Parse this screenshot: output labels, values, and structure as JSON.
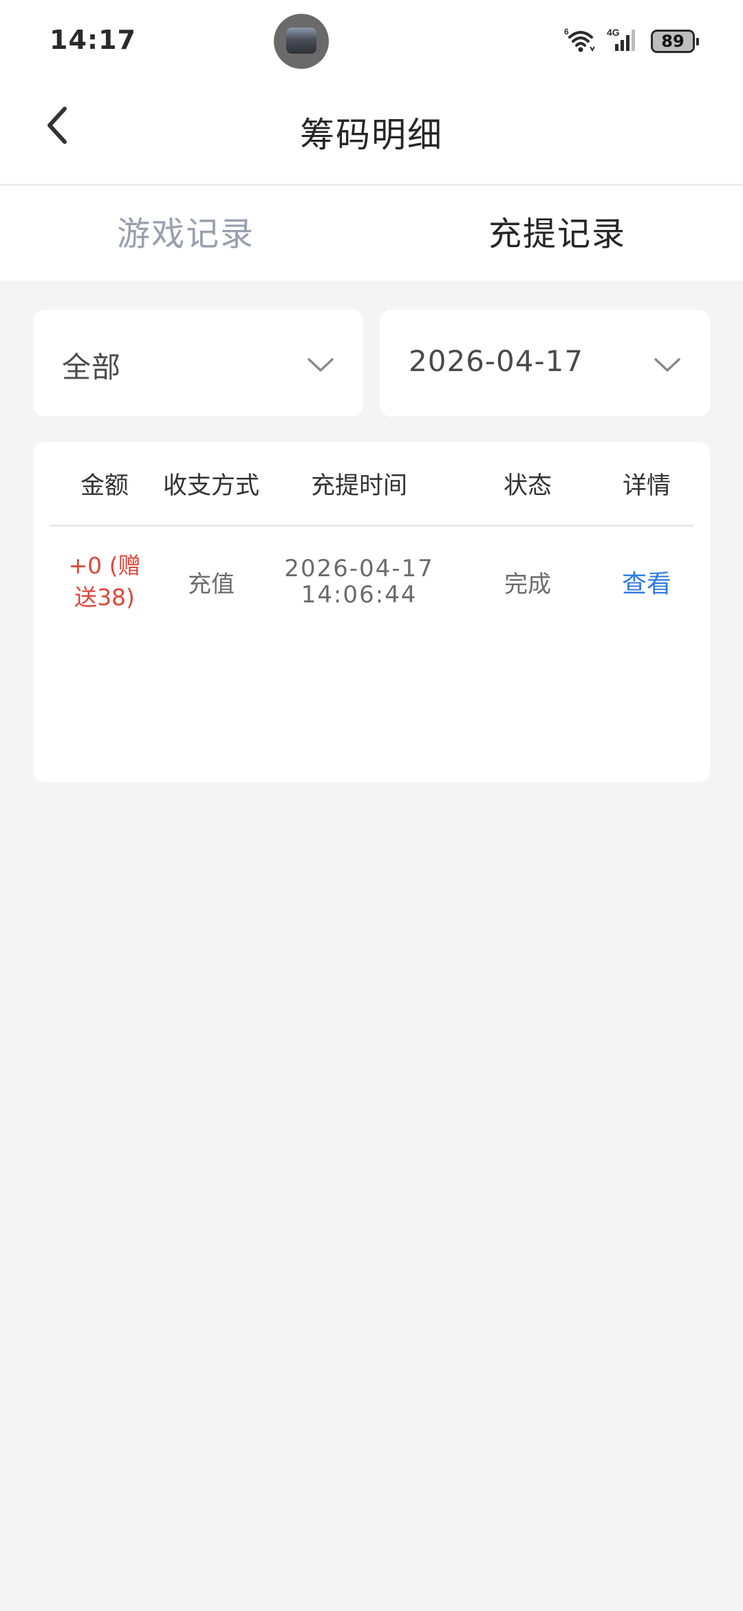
{
  "status_bar": {
    "time": "14:17",
    "battery": "89",
    "icons": [
      "wifi-icon",
      "cellular-4g-icon",
      "battery-icon"
    ]
  },
  "header": {
    "title": "筹码明细"
  },
  "tabs": [
    {
      "label": "游戏记录",
      "active": false
    },
    {
      "label": "充提记录",
      "active": true
    }
  ],
  "filters": {
    "type": "全部",
    "date": "2026-04-17"
  },
  "table": {
    "columns": [
      "金额",
      "收支方式",
      "充提时间",
      "状态",
      "详情"
    ],
    "rows": [
      {
        "amount_line1": "+0 (赠",
        "amount_line2": "送38)",
        "method": "充值",
        "date": "2026-04-17",
        "time": "14:06:44",
        "status": "完成",
        "detail": "查看"
      }
    ]
  },
  "colors": {
    "accent_link": "#2f7ae5",
    "amount_red": "#e0463a",
    "background": "#f4f4f4"
  }
}
